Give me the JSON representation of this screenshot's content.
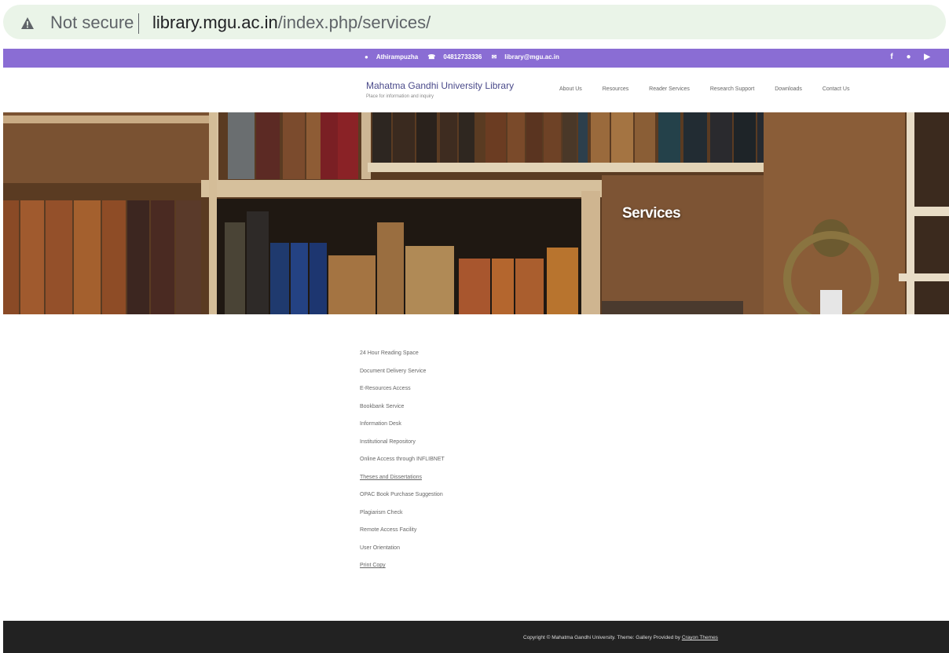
{
  "browser": {
    "security_label": "Not secure",
    "url_host": "library.mgu.ac.in",
    "url_path": "/index.php/services/"
  },
  "topbar": {
    "location": "Athirampuzha",
    "phone": "04812733336",
    "email": "library@mgu.ac.in",
    "social_icons": [
      "facebook-icon",
      "twitter-icon",
      "youtube-icon"
    ]
  },
  "header": {
    "site_title": "Mahatma Gandhi University Library",
    "tagline": "Place for information and inquiry",
    "nav": [
      "About Us",
      "Resources",
      "Reader Services",
      "Research Support",
      "Downloads",
      "Contact Us"
    ]
  },
  "hero": {
    "title": "Services"
  },
  "services": [
    "24 Hour Reading Space",
    "Document Delivery Service",
    "E-Resources Access",
    "Bookbank Service",
    "Information Desk",
    "Institutional Repository",
    "Online Access through INFLIBNET",
    "Theses and Dissertations",
    "OPAC Book Purchase Suggestion",
    "Plagiarism Check",
    "Remote Access Facility",
    "User Orientation",
    "Print Copy"
  ],
  "footer": {
    "copyright": "Copyright © Mahatma Gandhi University. Theme: Gallery Provided by",
    "credit": "Crayon Themes"
  },
  "colors": {
    "topbar": "#8a6dd4",
    "footer": "#222222",
    "address_bar": "#eaf4e8"
  }
}
